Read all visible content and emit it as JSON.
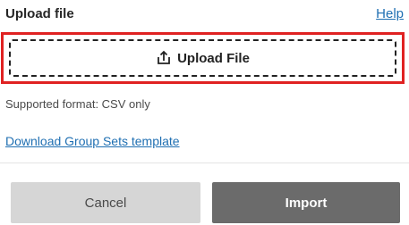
{
  "header": {
    "title": "Upload file",
    "help_label": "Help"
  },
  "upload": {
    "label": "Upload File",
    "icon": "upload-icon"
  },
  "hint": "Supported format: CSV only",
  "template_link": "Download Group Sets template",
  "footer": {
    "cancel_label": "Cancel",
    "import_label": "Import"
  },
  "colors": {
    "highlight_border": "#e02222",
    "link": "#1f6fb2",
    "cancel_bg": "#d6d6d6",
    "import_bg": "#6b6b6b"
  }
}
